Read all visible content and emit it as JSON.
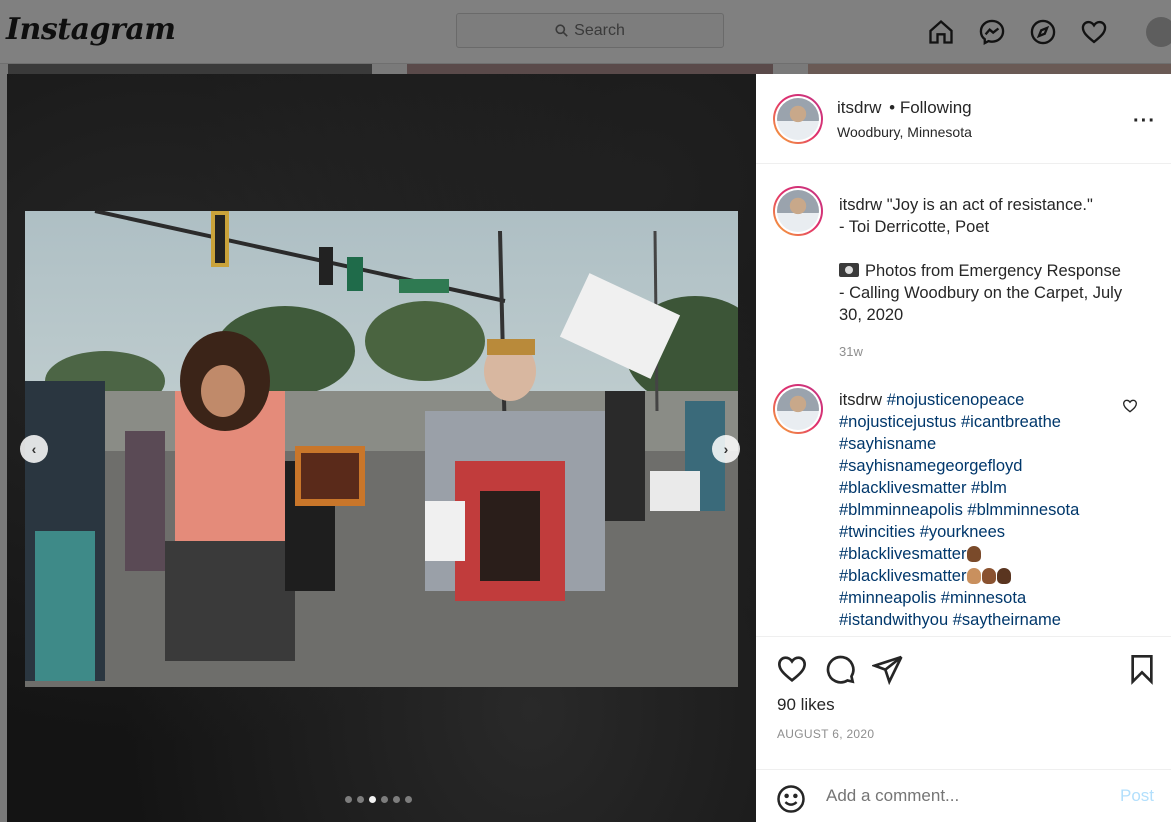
{
  "nav": {
    "logo": "Instagram",
    "search_placeholder": "Search",
    "icons": [
      "home-icon",
      "messenger-icon",
      "explore-icon",
      "activity-heart-icon",
      "profile-avatar"
    ]
  },
  "post": {
    "username": "itsdrw",
    "follow_status": "• Following",
    "location": "Woodbury, Minnesota",
    "carousel": {
      "total": 6,
      "active_index": 2
    }
  },
  "comments": [
    {
      "username": "itsdrw",
      "lines": [
        "\"Joy is an act of resistance.\"",
        "- Toi Derricotte, Poet",
        "",
        "Photos from Emergency Response",
        "- Calling Woodbury on the Carpet, July",
        "30, 2020"
      ],
      "age": "31w"
    },
    {
      "username": "itsdrw",
      "lines": [
        "#nojusticenopeace",
        "#nojusticejustus #icantbreathe",
        "#sayhisname",
        "#sayhisnamegeorgefloyd",
        "#blacklivesmatter #blm",
        "#blmminneapolis #blmminnesota",
        "#twincities #yourknees",
        "#blacklivesmatter",
        "#blacklivesmatter",
        "#minneapolis #minnesota",
        "#istandwithyou #saytheirname"
      ]
    }
  ],
  "actions": {
    "likes": "90 likes",
    "date": "AUGUST 6, 2020",
    "comment_placeholder": "Add a comment...",
    "post_label": "Post"
  },
  "colors": {
    "link": "#00376b",
    "post_disabled": "#b2dffc",
    "muted": "#8e8e8e"
  }
}
